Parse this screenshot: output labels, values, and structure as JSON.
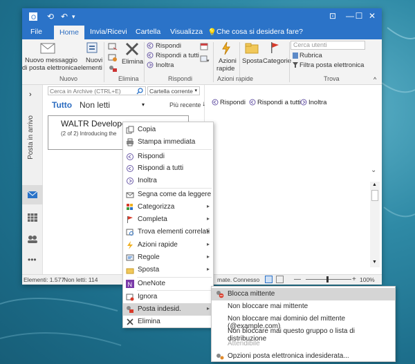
{
  "window": {
    "undo_symbol": "↶",
    "minimize": "—",
    "maximize": "☐",
    "close": "✕"
  },
  "tabs": [
    "File",
    "Home",
    "Invia/Ricevi",
    "Cartella",
    "Visualizza"
  ],
  "tell_me": "Che cosa si desidera fare?",
  "ribbon": {
    "nuovo_messaggio_1": "Nuovo messaggio",
    "nuovo_messaggio_2": "di posta elettronica",
    "nuovi_1": "Nuovi",
    "nuovi_2": "elementi",
    "elimina": "Elimina",
    "rispondi": "Rispondi",
    "rispondi_tutti": "Rispondi a tutti",
    "inoltra": "Inoltra",
    "azioni_1": "Azioni",
    "azioni_2": "rapide",
    "sposta": "Sposta",
    "categorie": "Categorie",
    "cerca_utenti": "Cerca utenti",
    "rubrica": "Rubrica",
    "filtra": "Filtra posta elettronica",
    "groups": {
      "nuovo": "Nuovo",
      "elimina": "Elimina",
      "rispondi": "Rispondi",
      "azioni": "Azioni rapide",
      "trova": "Trova"
    }
  },
  "search": {
    "placeholder": "Cerca in Archive (CTRL+E)",
    "scope": "Cartella corrente"
  },
  "nav": {
    "folder_label": "Posta in arrivo"
  },
  "list": {
    "filter_all": "Tutto",
    "filter_unread": "Non letti",
    "sort": "Più recente",
    "item": {
      "sender": "WALTR Developers",
      "preview": "(2 of 2) Introducing the"
    }
  },
  "reading_actions": {
    "rispondi": "Rispondi",
    "rispondi_tutti": "Rispondi a tutti",
    "inoltra": "Inoltra"
  },
  "status": {
    "elementi": "Elementi: 1.577",
    "non_letti": "Non letti: 114",
    "state_partial": "mate.",
    "connesso": "Connesso",
    "zoom": "100%"
  },
  "context_menu": [
    {
      "label": "Copia",
      "icon": "copy-icon"
    },
    {
      "label": "Stampa immediata",
      "icon": "print-icon"
    },
    {
      "label": "Rispondi",
      "icon": "reply-icon"
    },
    {
      "label": "Rispondi a tutti",
      "icon": "reply-all-icon"
    },
    {
      "label": "Inoltra",
      "icon": "forward-icon"
    },
    {
      "label": "Segna come da leggere",
      "icon": "envelope-icon"
    },
    {
      "label": "Categorizza",
      "icon": "categorize-icon"
    },
    {
      "label": "Completa",
      "icon": "flag-icon"
    },
    {
      "label": "Trova elementi correlati",
      "icon": "find-icon"
    },
    {
      "label": "Azioni rapide",
      "icon": "lightning-icon"
    },
    {
      "label": "Regole",
      "icon": "rules-icon"
    },
    {
      "label": "Sposta",
      "icon": "move-icon"
    },
    {
      "label": "OneNote",
      "icon": "onenote-icon"
    },
    {
      "label": "Ignora",
      "icon": "ignore-icon"
    },
    {
      "label": "Posta indesid.",
      "icon": "junk-icon"
    },
    {
      "label": "Elimina",
      "icon": "delete-icon"
    }
  ],
  "submenu": [
    "Blocca mittente",
    "Non bloccare mai mittente",
    "Non bloccare mai dominio del mittente (@example.com)",
    "Non bloccare mai questo gruppo o lista di distribuzione",
    "Attendibile",
    "Opzioni posta elettronica indesiderata..."
  ],
  "colors": {
    "accent": "#2b73c8",
    "menu_highlight": "#d5d5d5"
  }
}
